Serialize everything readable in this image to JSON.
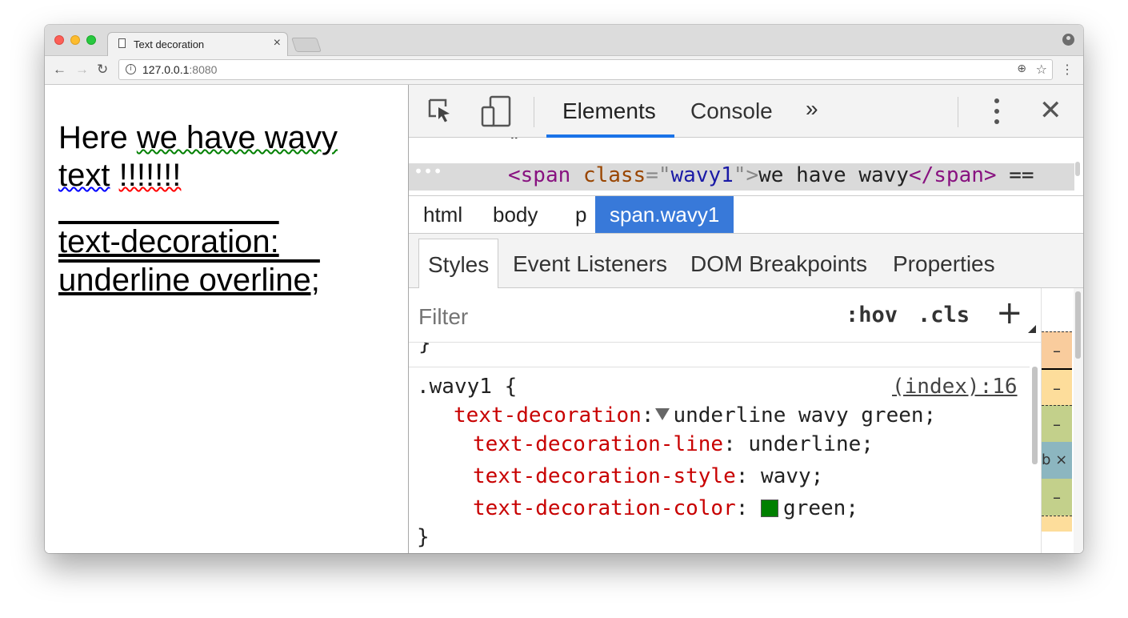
{
  "browser": {
    "tab_title": "Text decoration",
    "tab_close": "×",
    "url_host": "127.0.0.1",
    "url_port": ":8080",
    "nav_back": "←",
    "nav_forward": "→",
    "nav_reload": "↻",
    "omni_zoom": "⊕",
    "omni_star": "☆",
    "menu": "⋮",
    "info": "i"
  },
  "page": {
    "p1_a": "Here ",
    "p1_wavy1": "we have wavy",
    "p1_space1": " ",
    "p1_wavy2": "text",
    "p1_space2": " ",
    "p1_wavy3": "!!!!!!!",
    "p2": "text-decoration: underline overline;"
  },
  "devtools": {
    "tabs": [
      "Elements",
      "Console"
    ],
    "more": "»",
    "close": "✕",
    "tree": {
      "quote_line": "\"",
      "ellipsis": "•••",
      "lt": "<",
      "tag": "span",
      "attr": "class",
      "eq": "=\"",
      "attr_value": "wavy1",
      "q_gt": "\">",
      "text": "we have wavy",
      "close_lt": "</",
      "close_gt": ">",
      "trailer": " =="
    },
    "breadcrumbs": [
      "html",
      "body",
      "p",
      "span.wavy1"
    ],
    "subtabs": [
      "Styles",
      "Event Listeners",
      "DOM Breakpoints",
      "Properties"
    ],
    "filter_placeholder": "Filter",
    "hov": ":hov",
    "cls": ".cls",
    "plus": "+",
    "rule": {
      "prev_brace": "}",
      "selector": ".wavy1 {",
      "source": "(index):16",
      "shorthand_prop": "text-decoration",
      "shorthand_value": "underline wavy green;",
      "longhands": [
        {
          "prop": "text-decoration-line",
          "value": "underline;"
        },
        {
          "prop": "text-decoration-style",
          "value": "wavy;"
        },
        {
          "prop": "text-decoration-color",
          "value": "green;"
        }
      ],
      "close_brace": "}",
      "colon": ":"
    },
    "box_model_bands": [
      "–",
      "–",
      "–",
      "b × a",
      "–"
    ]
  },
  "colors": {
    "accent": "#1a73e8",
    "breadcrumb_active": "#3879d9",
    "css_prop": "#c80000",
    "tag": "#881280",
    "attr": "#994500",
    "attr_value": "#1a1aa6",
    "swatch": "#008000",
    "margin_band": "#f9cc9d",
    "border_band": "#fddd9b",
    "padding_band": "#c3d08b",
    "content_band": "#8cb6c0"
  },
  "icons": [
    "inspect-element-icon",
    "device-toolbar-icon",
    "kebab-menu-icon",
    "close-icon",
    "reload-icon",
    "info-icon",
    "zoom-icon",
    "star-icon",
    "profile-icon",
    "document-icon"
  ]
}
